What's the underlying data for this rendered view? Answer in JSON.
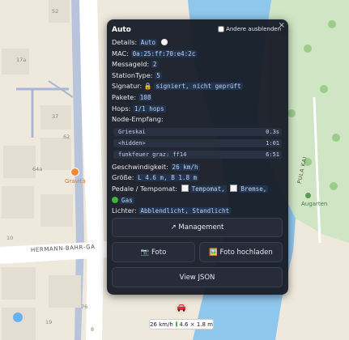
{
  "popup": {
    "title": "Auto",
    "hide_others_label": "Andere ausblenden",
    "close_glyph": "×",
    "details_label": "Details:",
    "details_value": "Auto",
    "mac_label": "MAC:",
    "mac_value": "0a:25:ff:70:e4:2c",
    "message_id_label": "MessageId:",
    "message_id_value": "2",
    "station_type_label": "StationType:",
    "station_type_value": "5",
    "signature_label": "Signatur:",
    "signature_value": "signiert, nicht geprüft",
    "packets_label": "Pakete:",
    "packets_value": "108",
    "hops_label": "Hops:",
    "hops_value": "1/1 hops",
    "node_reception_label": "Node-Empfang:",
    "nodes": [
      {
        "name": "Grieskai",
        "value": "0.3s"
      },
      {
        "name": "<hidden>",
        "value": "1:01"
      },
      {
        "name": "funkfeuer graz: ff14",
        "value": "6:51"
      }
    ],
    "speed_label": "Geschwindigkeit:",
    "speed_value": "26 km/h",
    "size_label": "Größe:",
    "size_value": "L 4.6 m, B 1.8 m",
    "pedals_label": "Pedale / Tempomat:",
    "pedal_tempomat": "Tempomat,",
    "pedal_brake": "Bremse,",
    "pedal_gas": "Gas",
    "lights_label": "Lichter:",
    "lights_value": "Abblendlicht, Standlicht",
    "buttons": {
      "management": "↗ Management",
      "photo": "📷 Foto",
      "photo_upload": "🖼️ Foto hochladen",
      "view_json": "View JSON"
    }
  },
  "map": {
    "labels": {
      "house_52": "52",
      "house_17a": "17a",
      "house_37": "37",
      "house_62": "62",
      "house_64a": "64a",
      "house_10": "10",
      "house_76": "76",
      "house_19": "19",
      "house_8": "8",
      "street_hermann_bahr": "HERMANN-BAHR-GA",
      "poi_gravita": "Gravità",
      "poi_augarten": "Augarten",
      "street_pula_kai": "PULA KAI"
    }
  },
  "vehicle_badge": {
    "speed": "26 km/h",
    "size": "4.6 × 1.8 m"
  },
  "colors": {
    "popup_bg": "#161b26",
    "code_text": "#bcd4f0",
    "river": "#8fc6ec",
    "park": "#cfe5c4",
    "accent_green": "#3cb43c"
  }
}
